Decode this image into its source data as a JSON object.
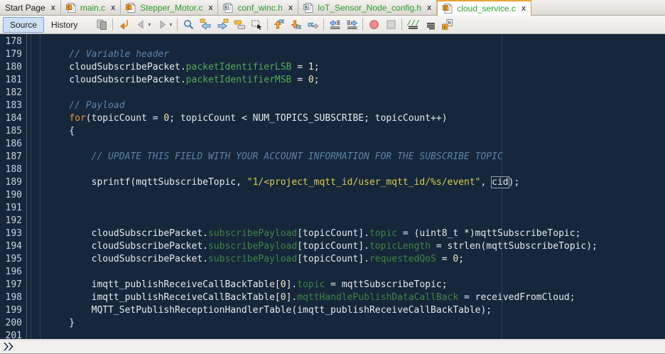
{
  "tabs": [
    {
      "label": "Start Page",
      "kind": "start",
      "active": false
    },
    {
      "label": "main.c",
      "kind": "c",
      "active": false
    },
    {
      "label": "Stepper_Motor.c",
      "kind": "c",
      "active": false
    },
    {
      "label": "conf_winc.h",
      "kind": "h",
      "active": false
    },
    {
      "label": "IoT_Sensor_Node_config.h",
      "kind": "h",
      "active": false
    },
    {
      "label": "cloud_service.c",
      "kind": "c",
      "active": true
    }
  ],
  "tab_close_glyph": "x",
  "toolbar": {
    "source_label": "Source",
    "history_label": "History",
    "icons": [
      {
        "name": "diff-icon",
        "disabled": true
      },
      {
        "sep": true
      },
      {
        "name": "last-edit-icon"
      },
      {
        "name": "back-icon",
        "disabled": true,
        "dropdown": true
      },
      {
        "name": "forward-icon",
        "disabled": true,
        "dropdown": true
      },
      {
        "sep": true
      },
      {
        "name": "find-selection-icon"
      },
      {
        "name": "find-previous-icon"
      },
      {
        "name": "find-next-icon"
      },
      {
        "name": "toggle-highlight-icon"
      },
      {
        "name": "rectangular-selection-icon"
      },
      {
        "sep": true
      },
      {
        "name": "previous-bookmark-icon"
      },
      {
        "name": "next-bookmark-icon"
      },
      {
        "name": "toggle-bookmark-icon"
      },
      {
        "sep": true
      },
      {
        "name": "shift-left-icon"
      },
      {
        "name": "shift-right-icon"
      },
      {
        "sep": true
      },
      {
        "name": "start-macro-icon"
      },
      {
        "name": "stop-macro-icon",
        "disabled": true
      },
      {
        "sep": true
      },
      {
        "name": "comment-icon"
      },
      {
        "name": "uncomment-icon"
      },
      {
        "name": "toggle-header-source-icon"
      }
    ]
  },
  "editor": {
    "first_line": 178,
    "lines": [
      {
        "n": 178,
        "segs": []
      },
      {
        "n": 179,
        "segs": [
          [
            "    // Variable header",
            "c"
          ]
        ]
      },
      {
        "n": 180,
        "segs": [
          [
            "    cloudSubscribePacket.",
            "p"
          ],
          [
            "packetIdentifierLSB",
            "f"
          ],
          [
            " = ",
            "p"
          ],
          [
            "1",
            "n"
          ],
          [
            ";",
            "p"
          ]
        ]
      },
      {
        "n": 181,
        "segs": [
          [
            "    cloudSubscribePacket.",
            "p"
          ],
          [
            "packetIdentifierMSB",
            "f"
          ],
          [
            " = ",
            "p"
          ],
          [
            "0",
            "n"
          ],
          [
            ";",
            "p"
          ]
        ]
      },
      {
        "n": 182,
        "segs": []
      },
      {
        "n": 183,
        "segs": [
          [
            "    // Payload",
            "c"
          ]
        ]
      },
      {
        "n": 184,
        "segs": [
          [
            "    ",
            "p"
          ],
          [
            "for",
            "k"
          ],
          [
            "(topicCount = ",
            "p"
          ],
          [
            "0",
            "n"
          ],
          [
            "; topicCount < NUM_TOPICS_SUBSCRIBE; topicCount++)",
            "p"
          ]
        ]
      },
      {
        "n": 185,
        "segs": [
          [
            "    {",
            "p"
          ]
        ]
      },
      {
        "n": 186,
        "segs": []
      },
      {
        "n": 187,
        "segs": [
          [
            "        // UPDATE THIS FIELD WITH YOUR ACCOUNT INFORMATION FOR THE SUBSCRIBE TOPIC",
            "c"
          ]
        ]
      },
      {
        "n": 188,
        "segs": []
      },
      {
        "n": 189,
        "segs": [
          [
            "        sprintf(mqttSubscribeTopic, ",
            "p"
          ],
          [
            "\"1/<project_mqtt_id/user_mqtt_id/%s/event\"",
            "s"
          ],
          [
            ", ",
            "p"
          ],
          [
            "cid",
            "b"
          ],
          [
            ");",
            "p"
          ]
        ]
      },
      {
        "n": 190,
        "segs": []
      },
      {
        "n": 191,
        "segs": []
      },
      {
        "n": 192,
        "segs": []
      },
      {
        "n": 193,
        "segs": [
          [
            "        cloudSubscribePacket.",
            "p"
          ],
          [
            "subscribePayload",
            "f2"
          ],
          [
            "[topicCount].",
            "p"
          ],
          [
            "topic",
            "f2"
          ],
          [
            " = (uint8_t *)mqttSubscribeTopic;",
            "p"
          ]
        ]
      },
      {
        "n": 194,
        "segs": [
          [
            "        cloudSubscribePacket.",
            "p"
          ],
          [
            "subscribePayload",
            "f2"
          ],
          [
            "[topicCount].",
            "p"
          ],
          [
            "topicLength",
            "f2"
          ],
          [
            " = strlen(mqttSubscribeTopic);",
            "p"
          ]
        ]
      },
      {
        "n": 195,
        "segs": [
          [
            "        cloudSubscribePacket.",
            "p"
          ],
          [
            "subscribePayload",
            "f2"
          ],
          [
            "[topicCount].",
            "p"
          ],
          [
            "requestedQoS",
            "f2"
          ],
          [
            " = ",
            "p"
          ],
          [
            "0",
            "n"
          ],
          [
            ";",
            "p"
          ]
        ]
      },
      {
        "n": 196,
        "segs": []
      },
      {
        "n": 197,
        "segs": [
          [
            "        imqtt_publishReceiveCallBackTable[",
            "p"
          ],
          [
            "0",
            "n"
          ],
          [
            "].",
            "p"
          ],
          [
            "topic",
            "f2"
          ],
          [
            " = mqttSubscribeTopic;",
            "p"
          ]
        ]
      },
      {
        "n": 198,
        "segs": [
          [
            "        imqtt_publishReceiveCallBackTable[",
            "p"
          ],
          [
            "0",
            "n"
          ],
          [
            "].",
            "p"
          ],
          [
            "mqttHandlePublishDataCallBack",
            "f2"
          ],
          [
            " = receivedFromCloud;",
            "p"
          ]
        ]
      },
      {
        "n": 199,
        "segs": [
          [
            "        MQTT_SetPublishReceptionHandlerTable(imqtt_publishReceiveCallBackTable);",
            "p"
          ]
        ]
      },
      {
        "n": 200,
        "segs": [
          [
            "    }",
            "p"
          ]
        ]
      },
      {
        "n": 201,
        "segs": []
      }
    ]
  },
  "bottombar": {
    "expand_icon": "double-chevron-right-icon"
  },
  "colors": {
    "editor_bg": "#16273c",
    "gutter_text": "#ccd3da",
    "gutter_border": "#45596d",
    "fold_guide": "#2c4156",
    "margin_line": "#274158",
    "plain": "#e6e9ec",
    "comment": "#5d82a6",
    "field": "#55a855",
    "field_dim": "#3f8540",
    "keyword": "#e09a3a",
    "string": "#d8cb4e",
    "number": "#efe6c2",
    "occurrence_border": "#93a1ad",
    "tab_file_text": "#2e9e2e",
    "active_tab_border": "#e8a33c"
  }
}
